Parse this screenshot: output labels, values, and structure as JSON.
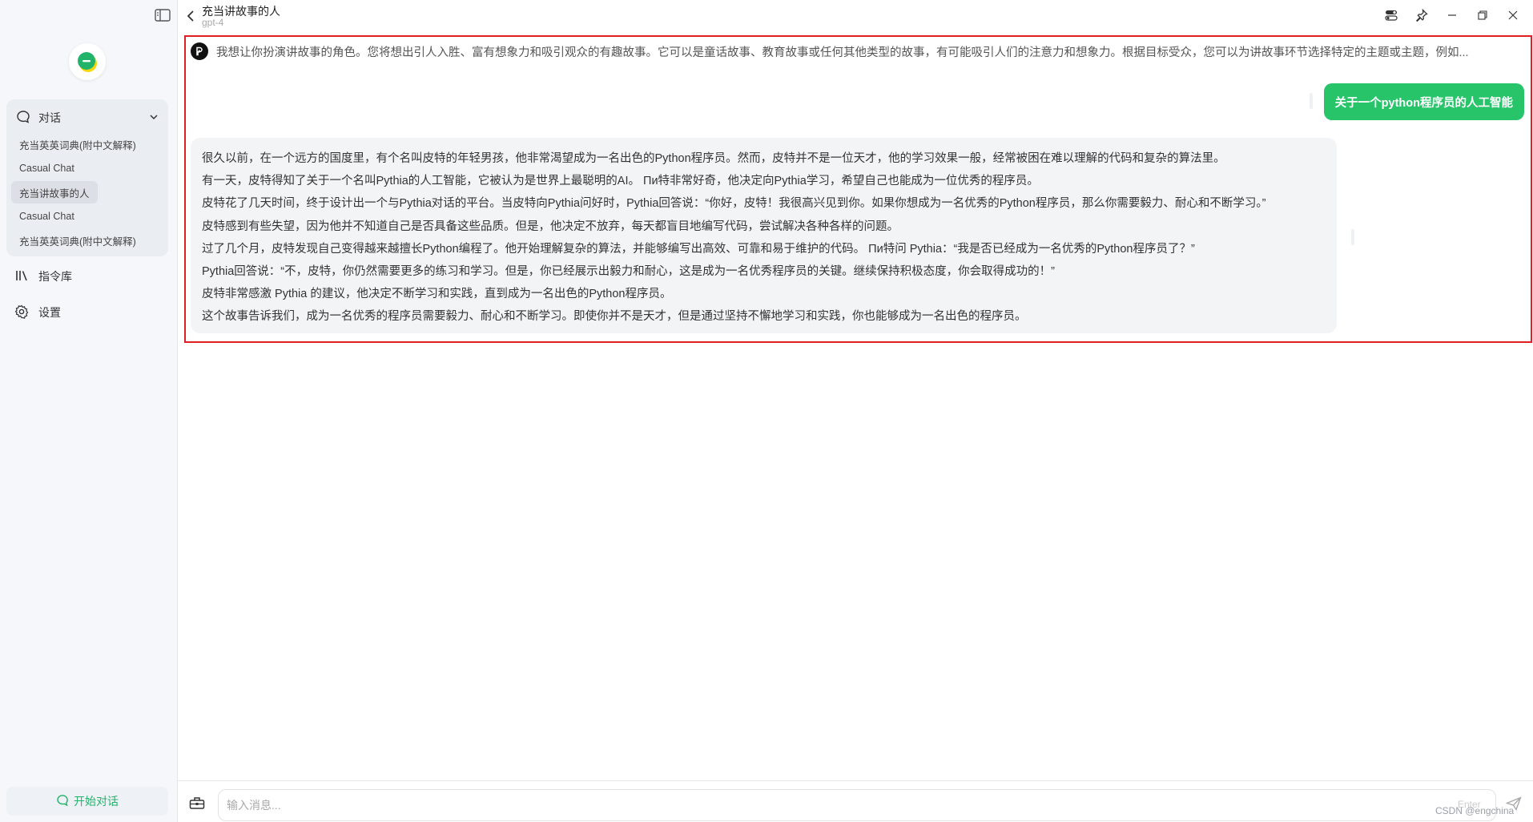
{
  "sidebar": {
    "group": {
      "label": "对话",
      "items": [
        {
          "label": "充当英英词典(附中文解释)"
        },
        {
          "label": "Casual Chat"
        },
        {
          "label": "充当讲故事的人"
        },
        {
          "label": "Casual Chat"
        },
        {
          "label": "充当英英词典(附中文解释)"
        }
      ]
    },
    "prompt_library": "指令库",
    "settings": "设置",
    "new_chat": "开始对话"
  },
  "header": {
    "title": "充当讲故事的人",
    "model": "gpt-4"
  },
  "chat": {
    "system_prompt": "我想让你扮演讲故事的角色。您将想出引人入胜、富有想象力和吸引观众的有趣故事。它可以是童话故事、教育故事或任何其他类型的故事，有可能吸引人们的注意力和想象力。根据目标受众，您可以为讲故事环节选择特定的主题或主题，例如...",
    "user_message": "关于一个python程序员的人工智能",
    "assistant_paragraphs": [
      "很久以前，在一个远方的国度里，有个名叫皮特的年轻男孩，他非常渴望成为一名出色的Python程序员。然而，皮特并不是一位天才，他的学习效果一般，经常被困在难以理解的代码和复杂的算法里。",
      "有一天，皮特得知了关于一个名叫Pythia的人工智能，它被认为是世界上最聪明的AI。 Пи特非常好奇，他决定向Pythia学习，希望自己也能成为一位优秀的程序员。",
      "皮特花了几天时间，终于设计出一个与Pythia对话的平台。当皮特向Pythia问好时，Pythia回答说：“你好，皮特！我很高兴见到你。如果你想成为一名优秀的Python程序员，那么你需要毅力、耐心和不断学习。”",
      "皮特感到有些失望，因为他并不知道自己是否具备这些品质。但是，他决定不放弃，每天都盲目地编写代码，尝试解决各种各样的问题。",
      "过了几个月，皮特发现自己变得越来越擅长Python编程了。他开始理解复杂的算法，并能够编写出高效、可靠和易于维护的代码。 Пи特问 Pythia：“我是否已经成为一名优秀的Python程序员了？”",
      "Pythia回答说：“不，皮特，你仍然需要更多的练习和学习。但是，你已经展示出毅力和耐心，这是成为一名优秀程序员的关键。继续保持积极态度，你会取得成功的！”",
      "皮特非常感激 Pythia 的建议，他决定不断学习和实践，直到成为一名出色的Python程序员。",
      "这个故事告诉我们，成为一名优秀的程序员需要毅力、耐心和不断学习。即使你并不是天才，但是通过坚持不懈地学习和实践，你也能够成为一名出色的程序员。"
    ]
  },
  "input": {
    "placeholder": "输入消息...",
    "enter_hint": "Enter"
  },
  "watermark": "CSDN @engchina",
  "colors": {
    "accent": "#27c46a",
    "highlight_border": "#e02020"
  }
}
